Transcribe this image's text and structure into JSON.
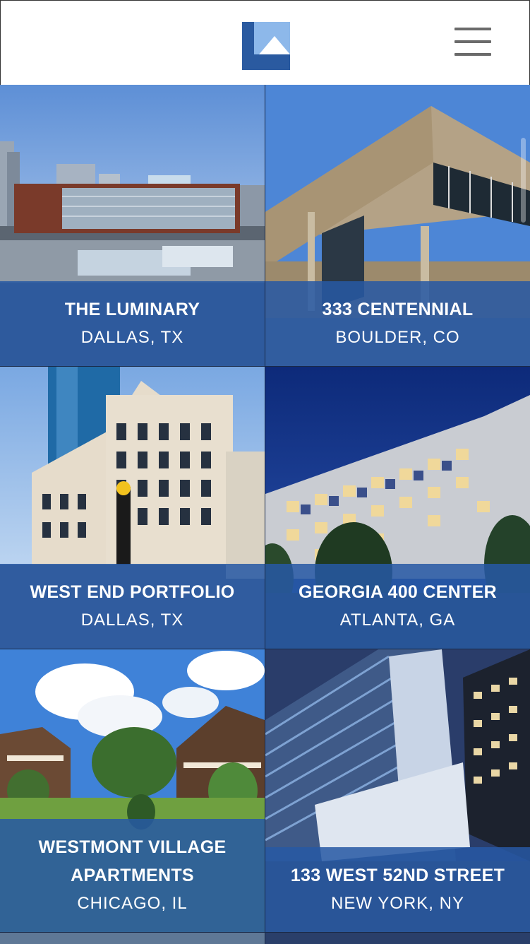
{
  "brand": {
    "logo_icon": "company-logo-icon",
    "colors": {
      "dark_blue": "#1e4f95",
      "light_blue": "#8bb4e6",
      "caption_blue": "#2658a4"
    }
  },
  "header": {
    "menu_icon": "hamburger-menu-icon"
  },
  "properties": [
    {
      "name": "THE LUMINARY",
      "location": "DALLAS, TX"
    },
    {
      "name": "333 CENTENNIAL",
      "location": "BOULDER, CO"
    },
    {
      "name": "WEST END PORTFOLIO",
      "location": "DALLAS, TX"
    },
    {
      "name": "GEORGIA 400 CENTER",
      "location": "ATLANTA, GA"
    },
    {
      "name": "WESTMONT VILLAGE\nAPARTMENTS",
      "location": "CHICAGO, IL"
    },
    {
      "name": "133 WEST 52ND STREET",
      "location": "NEW YORK, NY"
    }
  ]
}
